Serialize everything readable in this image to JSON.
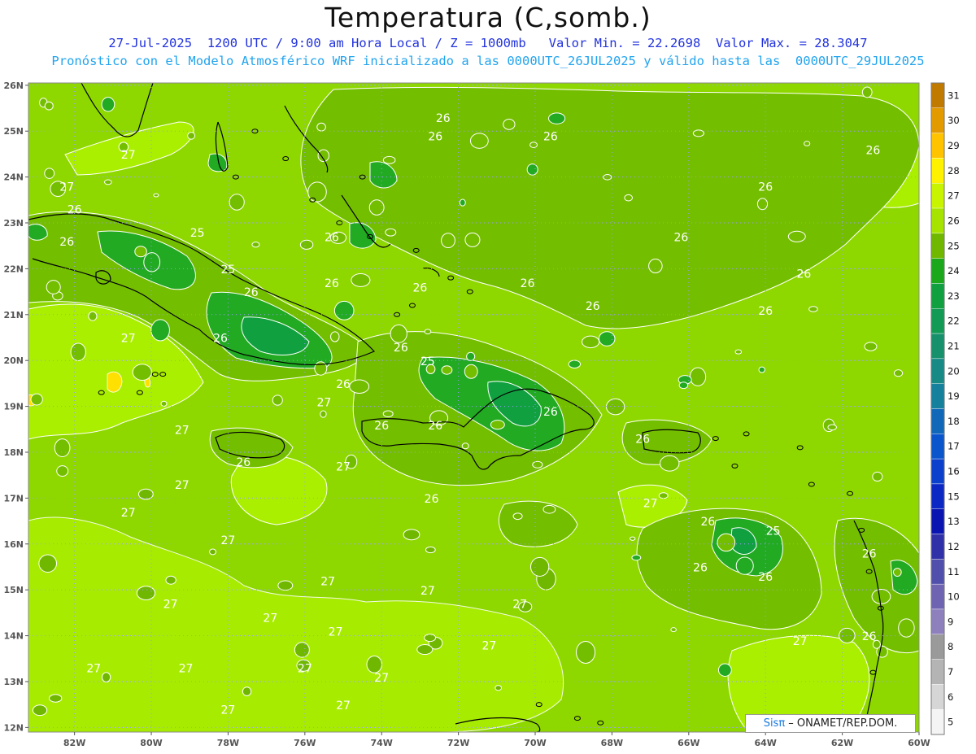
{
  "header": {
    "title": "Temperatura (C,somb.)",
    "line1": "27-Jul-2025  1200 UTC / 9:00 am Hora Local / Z = 1000mb   Valor Min. = 22.2698  Valor Max. = 28.3047",
    "line2": "Pronóstico con el Modelo Atmosférico WRF inicializado a las 0000UTC_26JUL2025 y válido hasta las  0000UTC_29JUL2025"
  },
  "credit": {
    "sis": "Sisπ",
    "rest": " – ONAMET/REP.DOM."
  },
  "map": {
    "lat_labels": [
      "26N",
      "25N",
      "24N",
      "23N",
      "22N",
      "21N",
      "20N",
      "19N",
      "18N",
      "17N",
      "16N",
      "15N",
      "14N",
      "13N",
      "12N"
    ],
    "lon_labels": [
      "82W",
      "80W",
      "78W",
      "76W",
      "74W",
      "72W",
      "70W",
      "68W",
      "66W",
      "64W",
      "62W",
      "60W"
    ],
    "background_color": "#8ed800",
    "contour_labels": [
      {
        "t": "27",
        "lon": -80.6,
        "lat": 24.4
      },
      {
        "t": "27",
        "lon": -82.2,
        "lat": 23.7
      },
      {
        "t": "26",
        "lon": -82.0,
        "lat": 23.2
      },
      {
        "t": "26",
        "lon": -82.2,
        "lat": 22.5
      },
      {
        "t": "25",
        "lon": -78.8,
        "lat": 22.7
      },
      {
        "t": "25",
        "lon": -78.0,
        "lat": 21.9
      },
      {
        "t": "26",
        "lon": -77.4,
        "lat": 21.4
      },
      {
        "t": "26",
        "lon": -75.3,
        "lat": 22.6
      },
      {
        "t": "26",
        "lon": -75.3,
        "lat": 21.6
      },
      {
        "t": "27",
        "lon": -80.6,
        "lat": 20.4
      },
      {
        "t": "26",
        "lon": -78.2,
        "lat": 20.4
      },
      {
        "t": "26",
        "lon": -75.0,
        "lat": 19.4
      },
      {
        "t": "27",
        "lon": -75.5,
        "lat": 19.0
      },
      {
        "t": "27",
        "lon": -79.2,
        "lat": 18.4
      },
      {
        "t": "26",
        "lon": -77.6,
        "lat": 17.7
      },
      {
        "t": "27",
        "lon": -75.0,
        "lat": 17.6
      },
      {
        "t": "27",
        "lon": -79.2,
        "lat": 17.2
      },
      {
        "t": "27",
        "lon": -80.6,
        "lat": 16.6
      },
      {
        "t": "27",
        "lon": -78.0,
        "lat": 16.0
      },
      {
        "t": "27",
        "lon": -75.4,
        "lat": 15.1
      },
      {
        "t": "27",
        "lon": -79.5,
        "lat": 14.6
      },
      {
        "t": "27",
        "lon": -76.9,
        "lat": 14.3
      },
      {
        "t": "27",
        "lon": -75.2,
        "lat": 14.0
      },
      {
        "t": "27",
        "lon": -72.8,
        "lat": 14.9
      },
      {
        "t": "27",
        "lon": -70.4,
        "lat": 14.6
      },
      {
        "t": "27",
        "lon": -71.2,
        "lat": 13.7
      },
      {
        "t": "27",
        "lon": -81.5,
        "lat": 13.2
      },
      {
        "t": "27",
        "lon": -79.1,
        "lat": 13.2
      },
      {
        "t": "27",
        "lon": -76.0,
        "lat": 13.2
      },
      {
        "t": "27",
        "lon": -74.0,
        "lat": 13.0
      },
      {
        "t": "27",
        "lon": -78.0,
        "lat": 12.3
      },
      {
        "t": "27",
        "lon": -75.0,
        "lat": 12.4
      },
      {
        "t": "26",
        "lon": -72.4,
        "lat": 25.2
      },
      {
        "t": "26",
        "lon": -72.6,
        "lat": 24.8
      },
      {
        "t": "26",
        "lon": -69.6,
        "lat": 24.8
      },
      {
        "t": "26",
        "lon": -66.2,
        "lat": 22.6
      },
      {
        "t": "26",
        "lon": -70.2,
        "lat": 21.6
      },
      {
        "t": "26",
        "lon": -68.5,
        "lat": 21.1
      },
      {
        "t": "26",
        "lon": -73.0,
        "lat": 21.5
      },
      {
        "t": "26",
        "lon": -73.5,
        "lat": 20.2
      },
      {
        "t": "25",
        "lon": -72.8,
        "lat": 19.9
      },
      {
        "t": "26",
        "lon": -74.0,
        "lat": 18.5
      },
      {
        "t": "26",
        "lon": -72.6,
        "lat": 18.5
      },
      {
        "t": "26",
        "lon": -69.6,
        "lat": 18.8
      },
      {
        "t": "26",
        "lon": -72.7,
        "lat": 16.9
      },
      {
        "t": "26",
        "lon": -67.2,
        "lat": 18.2
      },
      {
        "t": "27",
        "lon": -67.0,
        "lat": 16.8
      },
      {
        "t": "26",
        "lon": -61.2,
        "lat": 24.5
      },
      {
        "t": "26",
        "lon": -64.0,
        "lat": 23.7
      },
      {
        "t": "26",
        "lon": -63.0,
        "lat": 21.8
      },
      {
        "t": "26",
        "lon": -64.0,
        "lat": 21.0
      },
      {
        "t": "26",
        "lon": -65.5,
        "lat": 16.4
      },
      {
        "t": "25",
        "lon": -63.8,
        "lat": 16.2
      },
      {
        "t": "26",
        "lon": -65.7,
        "lat": 15.4
      },
      {
        "t": "26",
        "lon": -64.0,
        "lat": 15.2
      },
      {
        "t": "26",
        "lon": -61.3,
        "lat": 15.7
      },
      {
        "t": "27",
        "lon": -63.1,
        "lat": 13.8
      },
      {
        "t": "26",
        "lon": -61.3,
        "lat": 13.9
      }
    ]
  },
  "colorbar": {
    "labels": [
      "31",
      "30",
      "29",
      "28",
      "27",
      "26",
      "25",
      "24",
      "23",
      "22",
      "21",
      "20",
      "19",
      "18",
      "17",
      "16",
      "15",
      "13",
      "12",
      "11",
      "10",
      "9",
      "8",
      "7",
      "6",
      "5"
    ],
    "colors": [
      "#c07a00",
      "#e29a00",
      "#ffc300",
      "#fff200",
      "#c8f400",
      "#a6e400",
      "#70b800",
      "#1ca81c",
      "#10a040",
      "#139a55",
      "#17906c",
      "#178a86",
      "#15819c",
      "#1268b8",
      "#0a55cc",
      "#0a40cc",
      "#0b28c4",
      "#0a14b0",
      "#3030a8",
      "#5050ac",
      "#6e64b2",
      "#8e80bc",
      "#9a9a9a",
      "#b4b4b4",
      "#d6d6d6",
      "#f4f4f4"
    ]
  }
}
